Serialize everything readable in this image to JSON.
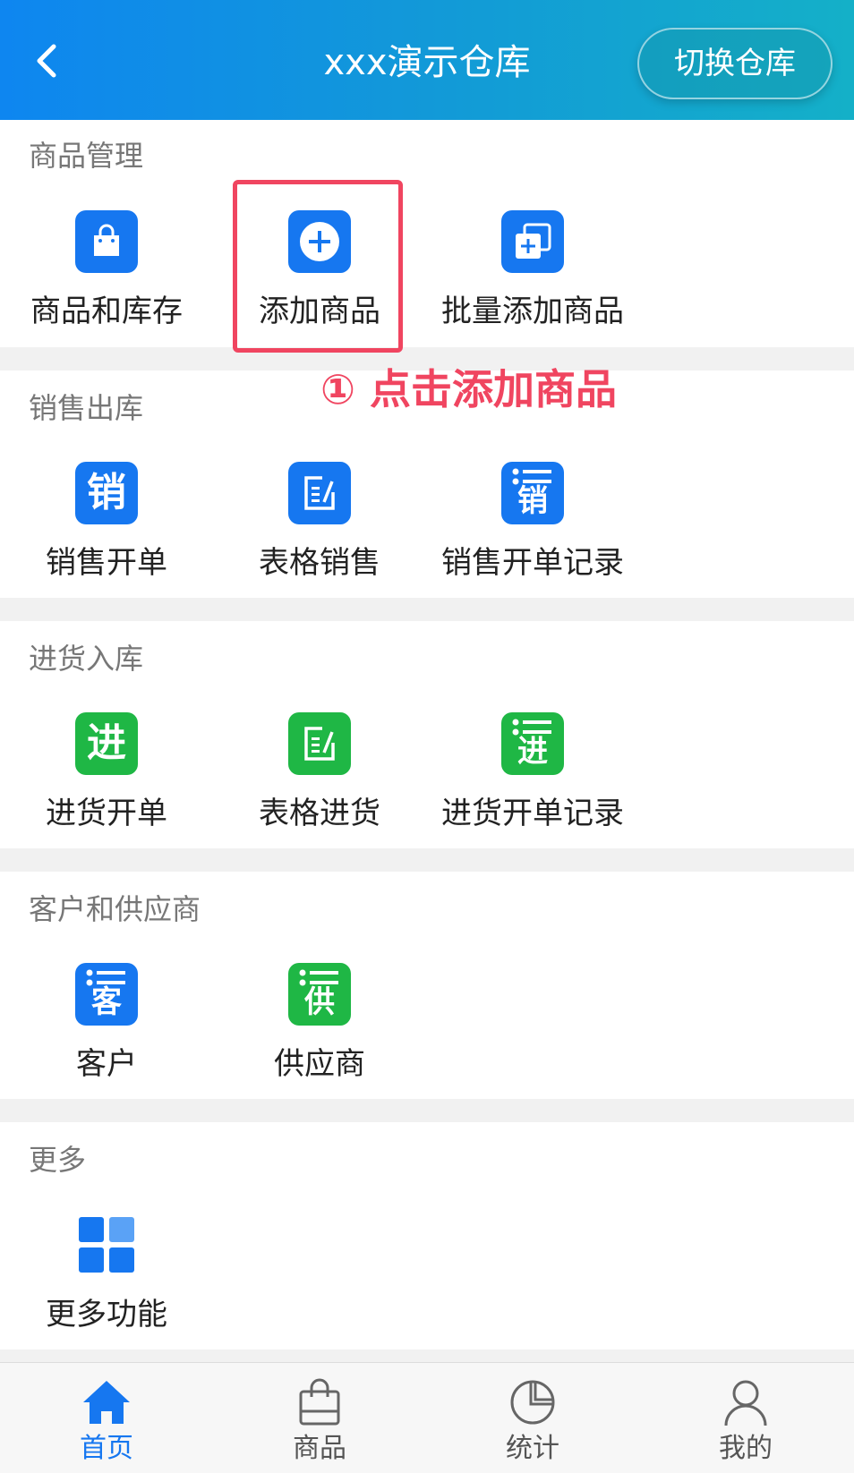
{
  "header": {
    "title": "xxx演示仓库",
    "switch_label": "切换仓库",
    "back_icon": "chevron-left-icon"
  },
  "colors": {
    "primary": "#1677f0",
    "green": "#1fb745",
    "annotation": "#f04560"
  },
  "sections": [
    {
      "title": "商品管理",
      "items": [
        {
          "label": "商品和库存",
          "icon": "shopping-bag-icon"
        },
        {
          "label": "添加商品",
          "icon": "plus-circle-icon"
        },
        {
          "label": "批量添加商品",
          "icon": "batch-add-icon"
        }
      ]
    },
    {
      "title": "销售出库",
      "items": [
        {
          "label": "销售开单",
          "icon": "sales-icon",
          "glyph": "销"
        },
        {
          "label": "表格销售",
          "icon": "table-edit-icon"
        },
        {
          "label": "销售开单记录",
          "icon": "sales-record-icon",
          "glyph": "销"
        }
      ]
    },
    {
      "title": "进货入库",
      "items": [
        {
          "label": "进货开单",
          "icon": "purchase-icon",
          "glyph": "进"
        },
        {
          "label": "表格进货",
          "icon": "table-edit-icon"
        },
        {
          "label": "进货开单记录",
          "icon": "purchase-record-icon",
          "glyph": "进"
        }
      ]
    },
    {
      "title": "客户和供应商",
      "items": [
        {
          "label": "客户",
          "icon": "customer-icon",
          "glyph": "客"
        },
        {
          "label": "供应商",
          "icon": "supplier-icon",
          "glyph": "供"
        }
      ]
    },
    {
      "title": "更多",
      "items": [
        {
          "label": "更多功能",
          "icon": "grid-icon"
        }
      ]
    }
  ],
  "annotation": {
    "text": "① 点击添加商品"
  },
  "tabbar": [
    {
      "label": "首页",
      "icon": "home-icon",
      "active": true
    },
    {
      "label": "商品",
      "icon": "shopping-bag-icon",
      "active": false
    },
    {
      "label": "统计",
      "icon": "pie-chart-icon",
      "active": false
    },
    {
      "label": "我的",
      "icon": "user-icon",
      "active": false
    }
  ]
}
